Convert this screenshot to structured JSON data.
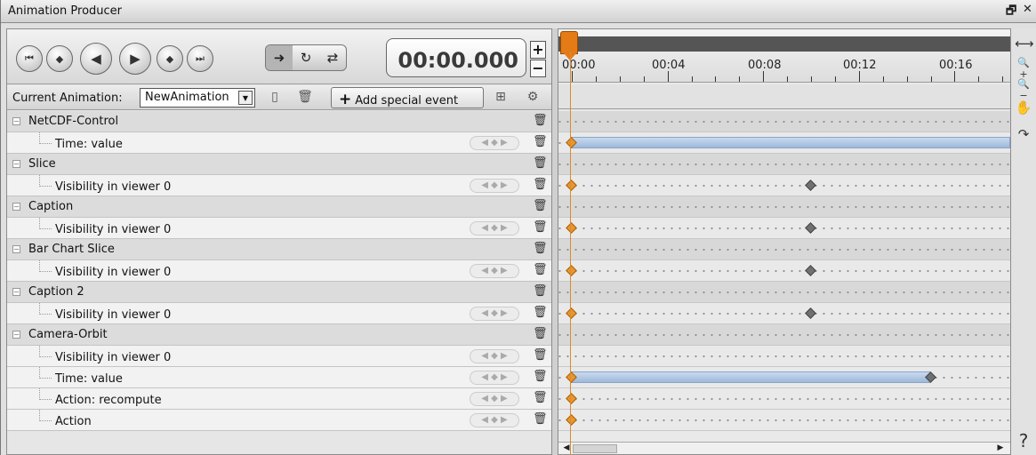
{
  "window": {
    "title": "Animation Producer",
    "float_glyph": "🗗",
    "close_glyph": "✕"
  },
  "playback": {
    "buttons": [
      {
        "name": "jump-start-button",
        "glyph": "⏮"
      },
      {
        "name": "prev-key-button",
        "glyph": "◆"
      },
      {
        "name": "step-back-button",
        "glyph": "◀"
      },
      {
        "name": "play-button",
        "glyph": "▶"
      },
      {
        "name": "next-key-button",
        "glyph": "◆"
      },
      {
        "name": "jump-end-button",
        "glyph": "⏭"
      }
    ],
    "modes": [
      "➜",
      "↻",
      "⇄"
    ],
    "time": "00:00.000",
    "spin_up": "+",
    "spin_down": "−"
  },
  "anim_bar": {
    "label": "Current Animation:",
    "selected_animation": "NewAnimation",
    "add_event_label": "Add special event"
  },
  "tracks": [
    {
      "name": "NetCDF-Control",
      "props": [
        {
          "name": "Time: value"
        }
      ]
    },
    {
      "name": "Slice",
      "props": [
        {
          "name": "Visibility in viewer 0"
        }
      ]
    },
    {
      "name": "Caption",
      "props": [
        {
          "name": "Visibility in viewer 0"
        }
      ]
    },
    {
      "name": "Bar Chart Slice",
      "props": [
        {
          "name": "Visibility in viewer 0"
        }
      ]
    },
    {
      "name": "Caption 2",
      "props": [
        {
          "name": "Visibility in viewer 0"
        }
      ]
    },
    {
      "name": "Camera-Orbit",
      "props": [
        {
          "name": "Visibility in viewer 0"
        },
        {
          "name": "Time: value"
        },
        {
          "name": "Action: recompute"
        },
        {
          "name": "Action"
        }
      ]
    }
  ],
  "timeline": {
    "ticks": [
      "00:00",
      "00:04",
      "00:08",
      "00:12",
      "00:16"
    ],
    "cursor_time_s": 0,
    "rows": [
      {
        "kind": "track",
        "keys": []
      },
      {
        "kind": "prop",
        "segment": [
          0,
          18.5
        ],
        "keys": [
          {
            "t": 0,
            "c": "orange"
          }
        ]
      },
      {
        "kind": "track",
        "keys": []
      },
      {
        "kind": "prop",
        "keys": [
          {
            "t": 0,
            "c": "orange"
          },
          {
            "t": 10,
            "c": "grey"
          }
        ]
      },
      {
        "kind": "track",
        "keys": []
      },
      {
        "kind": "prop",
        "keys": [
          {
            "t": 0,
            "c": "orange"
          },
          {
            "t": 10,
            "c": "grey"
          }
        ]
      },
      {
        "kind": "track",
        "keys": []
      },
      {
        "kind": "prop",
        "keys": [
          {
            "t": 0,
            "c": "orange"
          },
          {
            "t": 10,
            "c": "grey"
          }
        ]
      },
      {
        "kind": "track",
        "keys": []
      },
      {
        "kind": "prop",
        "keys": [
          {
            "t": 0,
            "c": "orange"
          },
          {
            "t": 10,
            "c": "grey"
          }
        ]
      },
      {
        "kind": "track",
        "keys": []
      },
      {
        "kind": "prop",
        "keys": []
      },
      {
        "kind": "prop",
        "segment": [
          0,
          15
        ],
        "keys": [
          {
            "t": 0,
            "c": "orange"
          },
          {
            "t": 15,
            "c": "grey"
          }
        ]
      },
      {
        "kind": "prop",
        "keys": [
          {
            "t": 0,
            "c": "orange"
          }
        ]
      },
      {
        "kind": "prop",
        "keys": [
          {
            "t": 0,
            "c": "orange"
          }
        ]
      }
    ]
  },
  "side_tools": [
    "⟷",
    "🔍+",
    "🔍−",
    "✋",
    "↷"
  ],
  "help_glyph": "?",
  "colors": {
    "cursor": "#e08a2a",
    "key_orange": "#e8962e",
    "segment": "#a9c1de"
  }
}
